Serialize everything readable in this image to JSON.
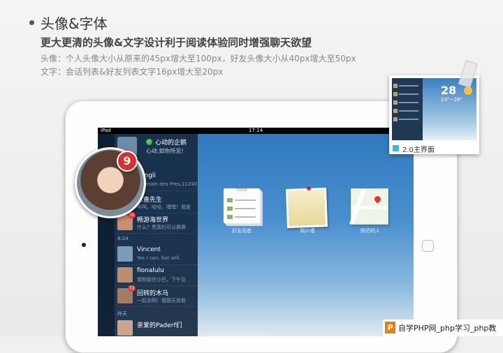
{
  "slide": {
    "title": "头像&字体",
    "subtitle": "更大更清的头像&文字设计利于阅读体验同时增强聊天欲望",
    "notes": [
      "头像：个人头像大小从原来的45px增大至100px，好友头像大小从40px增大至50px",
      "文字：会话列表&好友列表文字16px增大至20px"
    ]
  },
  "ipad": {
    "status": {
      "device": "iPad",
      "time": "17:14"
    },
    "me": {
      "name": "心动的企鹅",
      "signature": "心动,如你所见!"
    },
    "big_avatar_badge": "9",
    "conversations": [
      {
        "name": "elingli",
        "message": "Germain des Pres,11240",
        "badge": ""
      },
      {
        "name": "七喜先生",
        "message": "呵呵。哈哈，嘿嘿！我爱",
        "badge": ""
      },
      {
        "name": "畅游海世界",
        "message": "什么？票真的可以赛赛",
        "badge": "36"
      },
      {
        "name": "Vincent",
        "message": "Yes I can, but will.",
        "badge": ""
      },
      {
        "name": "fionalulu",
        "message": "我明前往沙巴，下午见",
        "badge": ""
      },
      {
        "name": "回转的木马",
        "message": "一起去啊！我那天放假",
        "badge": "72"
      },
      {
        "name": "亲爱的Paderf们",
        "message": "",
        "badge": ""
      }
    ],
    "sections": [
      "8:24",
      "昨天"
    ],
    "apps": [
      {
        "label": "好友动态",
        "header": "TODAY"
      },
      {
        "label": "照片墙"
      },
      {
        "label": "附近的人"
      }
    ]
  },
  "thumbnail": {
    "caption": "2.0主界面",
    "date": "28",
    "temperature": "23°~28°"
  },
  "watermark": {
    "logo": "P",
    "text": "自学PHP网_php学习_php教"
  },
  "colors": {
    "badge_red": "#d9302e",
    "sidebar": "#162a42",
    "accent_blue": "#4db1e0",
    "watermark_orange": "#f07b15"
  }
}
